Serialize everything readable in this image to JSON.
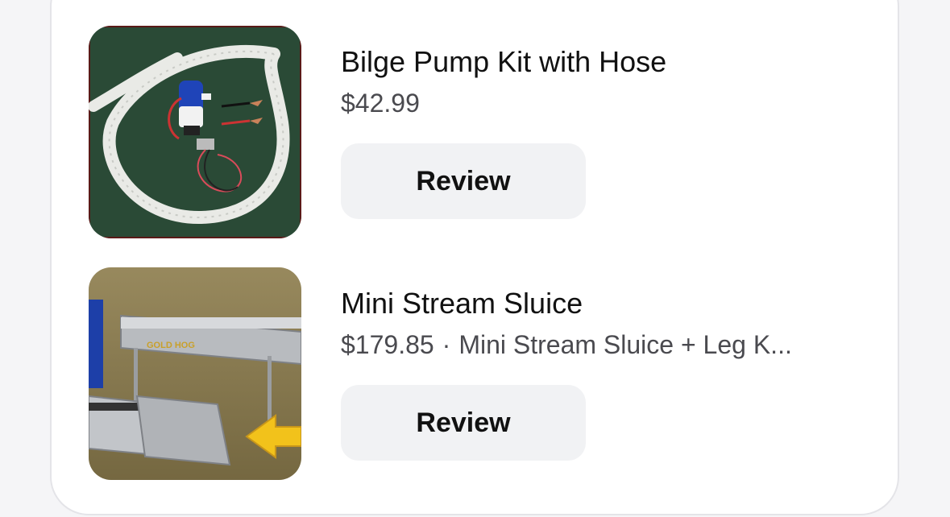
{
  "items": [
    {
      "title": "Bilge Pump Kit with Hose",
      "price": "$42.99",
      "review_label": "Review",
      "image_icon": "bilge-pump-kit-photo"
    },
    {
      "title": "Mini Stream Sluice",
      "price": "$179.85",
      "separator": "·",
      "variant": "Mini Stream Sluice + Leg K...",
      "review_label": "Review",
      "image_icon": "stream-sluice-photo",
      "image_brand_text": "GOLD HOG"
    }
  ]
}
